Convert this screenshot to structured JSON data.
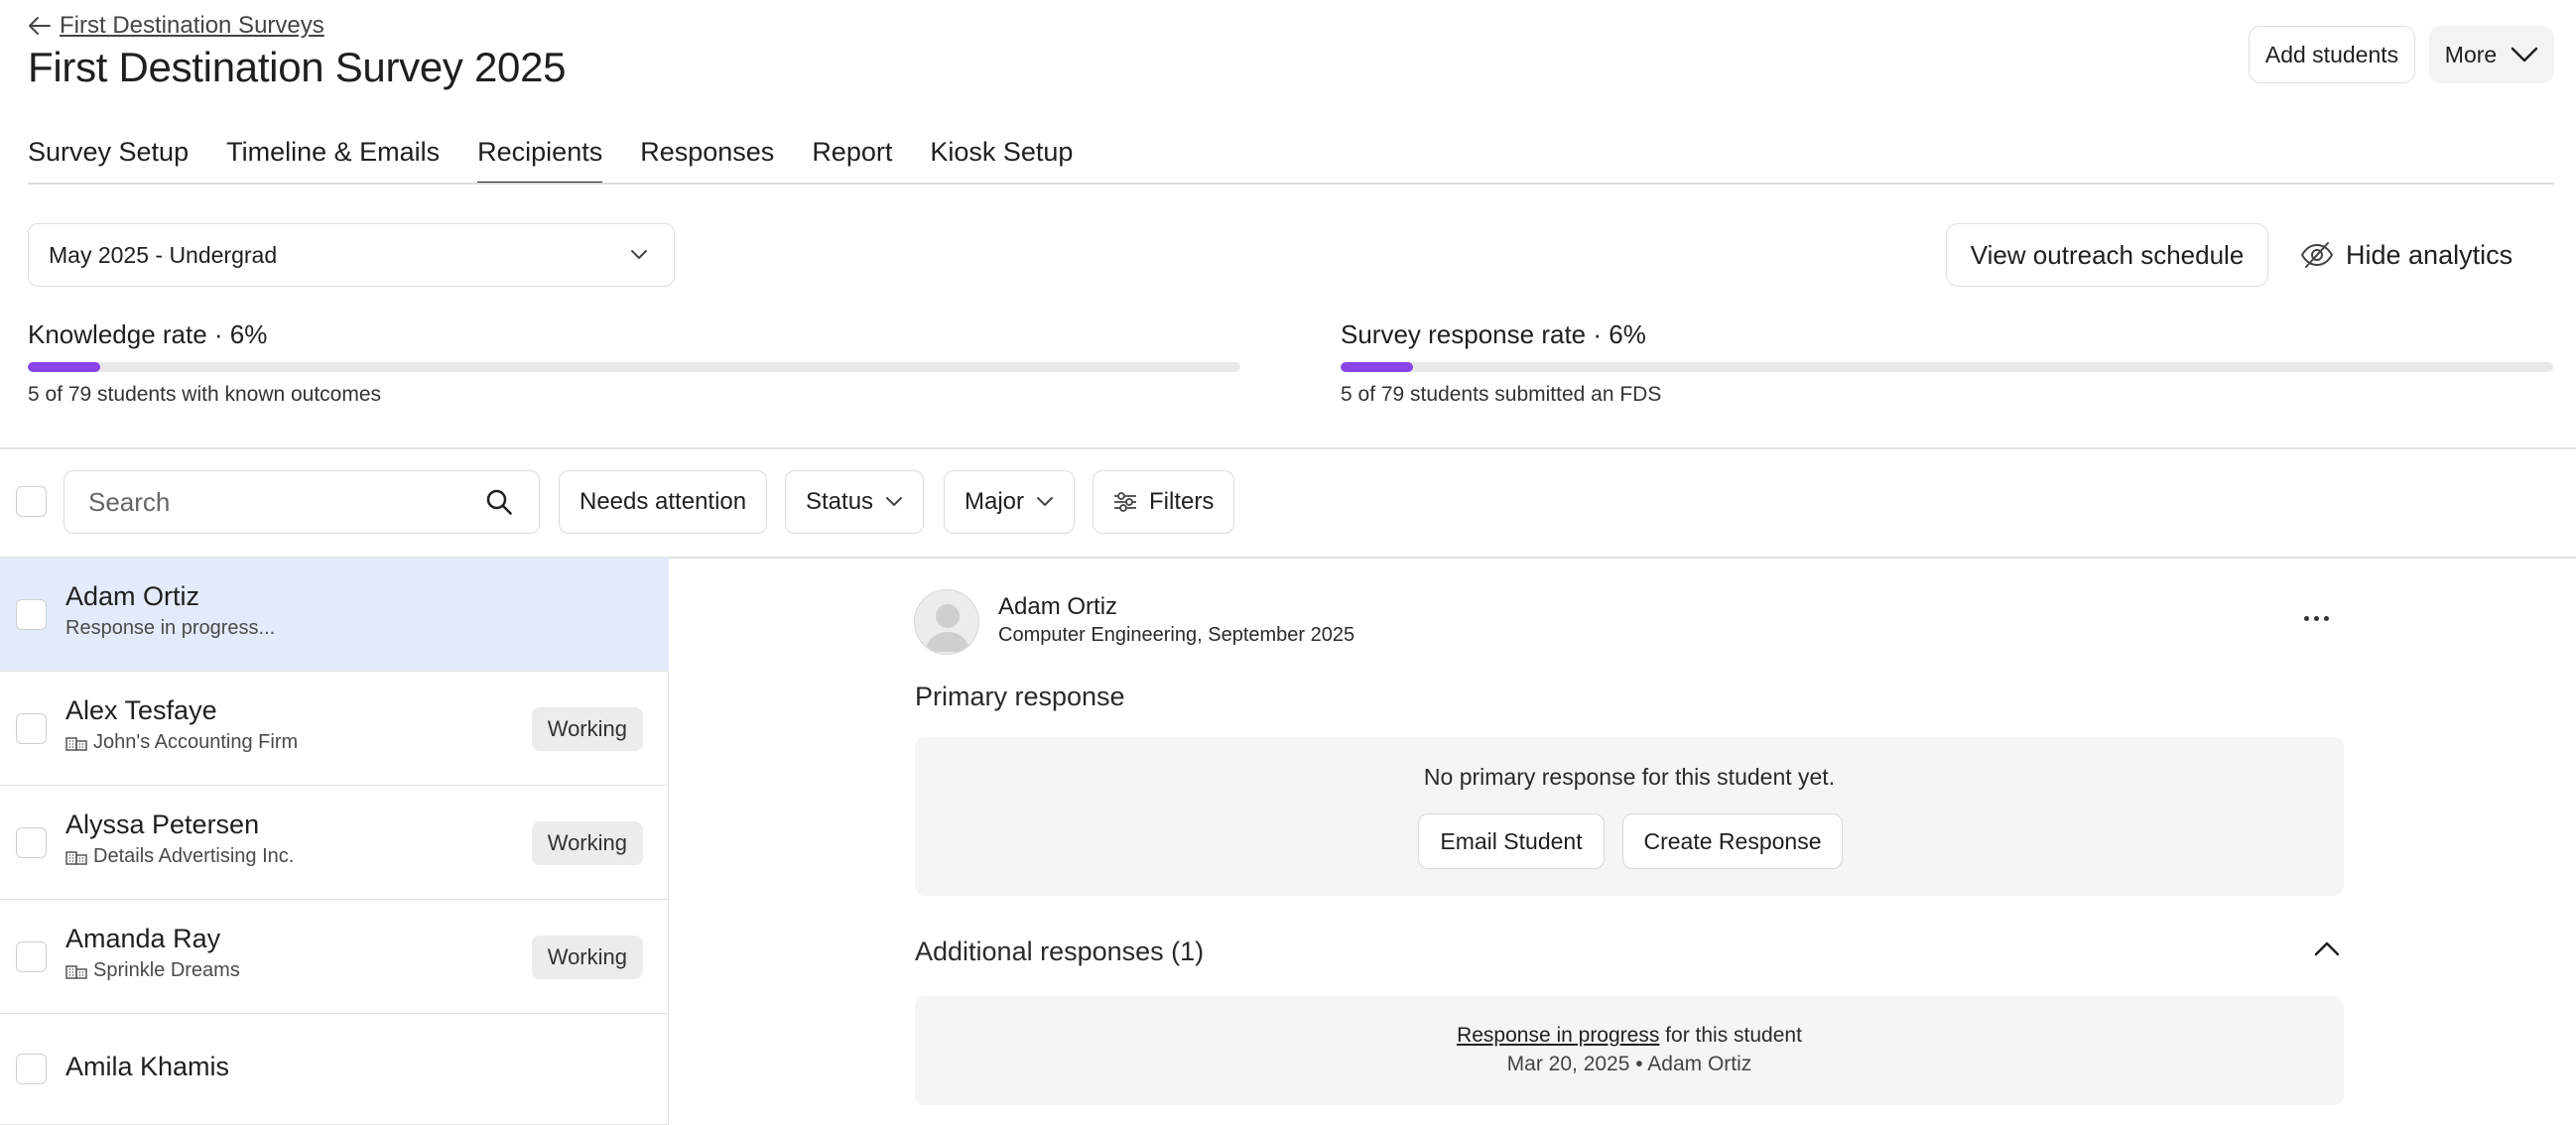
{
  "header": {
    "back_link": "First Destination Surveys",
    "title": "First Destination Survey 2025",
    "add_students": "Add students",
    "more": "More"
  },
  "tabs": [
    {
      "label": "Survey Setup",
      "active": false
    },
    {
      "label": "Timeline & Emails",
      "active": false
    },
    {
      "label": "Recipients",
      "active": true
    },
    {
      "label": "Responses",
      "active": false
    },
    {
      "label": "Report",
      "active": false
    },
    {
      "label": "Kiosk Setup",
      "active": false
    }
  ],
  "controls": {
    "cohort_selected": "May 2025 - Undergrad",
    "outreach_button": "View outreach schedule",
    "hide_analytics": "Hide analytics"
  },
  "analytics": {
    "knowledge": {
      "title": "Knowledge rate · 6%",
      "fraction": 0.06,
      "subtitle": "5 of 79 students with known outcomes"
    },
    "survey": {
      "title": "Survey response rate · 6%",
      "fraction": 0.06,
      "subtitle": "5 of 79 students submitted an FDS"
    },
    "accent_color": "#8a44e8"
  },
  "filters": {
    "search_placeholder": "Search",
    "needs_attention": "Needs attention",
    "status": "Status",
    "major": "Major",
    "filters": "Filters"
  },
  "students": [
    {
      "name": "Adam Ortiz",
      "subtitle": "Response in progress...",
      "employer": false,
      "badge": "",
      "selected": true
    },
    {
      "name": "Alex Tesfaye",
      "subtitle": "John's Accounting Firm",
      "employer": true,
      "badge": "Working",
      "selected": false
    },
    {
      "name": "Alyssa Petersen",
      "subtitle": "Details Advertising Inc.",
      "employer": true,
      "badge": "Working",
      "selected": false
    },
    {
      "name": "Amanda Ray",
      "subtitle": "Sprinkle Dreams",
      "employer": true,
      "badge": "Working",
      "selected": false
    },
    {
      "name": "Amila Khamis",
      "subtitle": "",
      "employer": false,
      "badge": "",
      "selected": false
    }
  ],
  "detail": {
    "name": "Adam Ortiz",
    "subtitle": "Computer Engineering, September 2025",
    "primary_heading": "Primary response",
    "primary_empty": "No primary response for this student yet.",
    "email_student": "Email Student",
    "create_response": "Create Response",
    "additional_heading": "Additional responses (1)",
    "additional_link": "Response in progress",
    "additional_suffix": " for this student",
    "additional_meta": "Mar 20, 2025 • Adam Ortiz"
  },
  "icons": {
    "back": "arrow-left-icon",
    "more": "chevron-down-icon",
    "search": "search-icon",
    "hide": "eye-off-icon",
    "filters": "sliders-icon",
    "employer": "building-icon",
    "kebab": "more-horizontal-icon",
    "collapse": "chevron-up-icon"
  }
}
